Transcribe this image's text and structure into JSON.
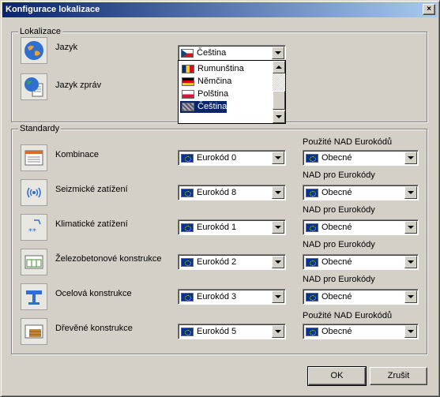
{
  "window": {
    "title": "Konfigurace lokalizace",
    "close_glyph": "×"
  },
  "localization": {
    "legend": "Lokalizace",
    "language_label": "Jazyk",
    "message_language_label": "Jazyk zpráv",
    "language_selected": "Čeština",
    "language_options": [
      "Rumunština",
      "Němčina",
      "Polština",
      "Čeština"
    ]
  },
  "standards": {
    "legend": "Standardy",
    "rows": [
      {
        "label": "Kombinace",
        "nad_header": "Použité NAD Eurokódů",
        "code": "Eurokód 0",
        "nad": "Obecné"
      },
      {
        "label": "Seizmické zatížení",
        "nad_header": "NAD pro Eurokódy",
        "code": "Eurokód 8",
        "nad": "Obecné"
      },
      {
        "label": "Klimatické zatížení",
        "nad_header": "NAD pro Eurokódy",
        "code": "Eurokód 1",
        "nad": "Obecné"
      },
      {
        "label": "Železobetonové konstrukce",
        "nad_header": "NAD pro Eurokódy",
        "code": "Eurokód 2",
        "nad": "Obecné"
      },
      {
        "label": "Ocelová konstrukce",
        "nad_header": "NAD pro Eurokódy",
        "code": "Eurokód 3",
        "nad": "Obecné"
      },
      {
        "label": "Dřevěné konstrukce",
        "nad_header": "Použité NAD Eurokódů",
        "code": "Eurokód 5",
        "nad": "Obecné"
      }
    ]
  },
  "buttons": {
    "ok": "OK",
    "cancel": "Zrušit"
  }
}
